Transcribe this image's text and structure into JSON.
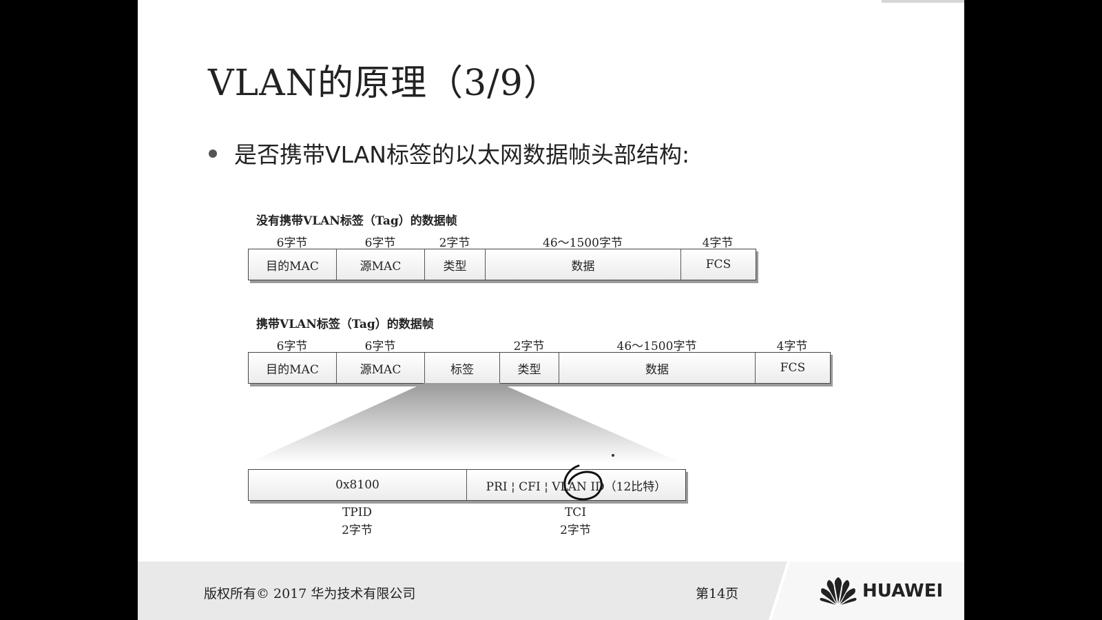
{
  "slide": {
    "title": "VLAN的原理（3/9）",
    "bullet": "是否携带VLAN标签的以太网数据帧头部结构:"
  },
  "frame_untagged": {
    "caption": "没有携带VLAN标签（Tag）的数据帧",
    "sizes": [
      "6字节",
      "6字节",
      "2字节",
      "46～1500字节",
      "4字节"
    ],
    "fields": [
      "目的MAC",
      "源MAC",
      "类型",
      "数据",
      "FCS"
    ]
  },
  "frame_tagged": {
    "caption": "携带VLAN标签（Tag）的数据帧",
    "sizes": [
      "6字节",
      "6字节",
      "2字节",
      "46～1500字节",
      "4字节"
    ],
    "fields": [
      "目的MAC",
      "源MAC",
      "标签",
      "类型",
      "数据",
      "FCS"
    ]
  },
  "tag_detail": {
    "tpid_value": "0x8100",
    "tci_fields": "PRI ¦ CFI ¦ VLAN ID（12比特）",
    "tpid_name": "TPID",
    "tpid_size": "2字节",
    "tci_name": "TCI",
    "tci_size": "2字节"
  },
  "annotation": {
    "handwritten_mark": "6",
    "color": "#111111"
  },
  "footer": {
    "copyright": "版权所有© 2017 华为技术有限公司",
    "page": "第14页",
    "brand": "HUAWEI"
  }
}
